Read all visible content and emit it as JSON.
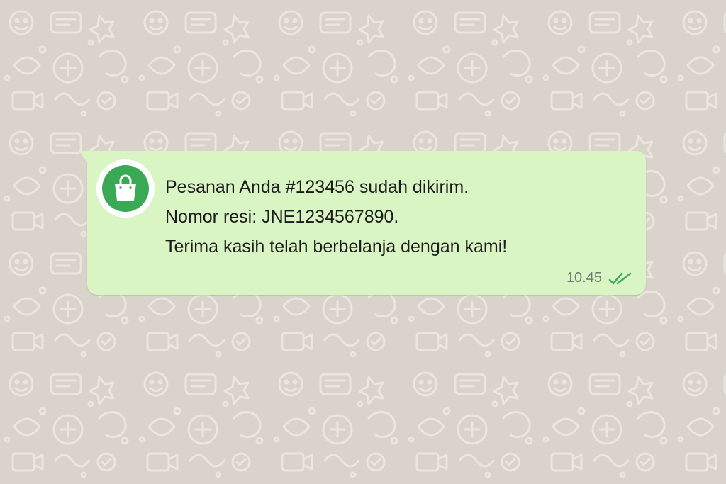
{
  "chat": {
    "wallpaper_color": "#d9d3cb",
    "pattern_color": "#ebe6df"
  },
  "message": {
    "avatar_icon": "shopping-bag-icon",
    "avatar_color": "#3aa955",
    "bubble_color": "#daf5c4",
    "lines": [
      "Pesanan Anda #123456 sudah dikirim.",
      "Nomor resi: JNE1234567890.",
      "Terima kasih telah berbelanja dengan kami!"
    ],
    "time": "10.45",
    "status_icon": "double-check-read-icon",
    "status_color": "#3fae5e"
  }
}
